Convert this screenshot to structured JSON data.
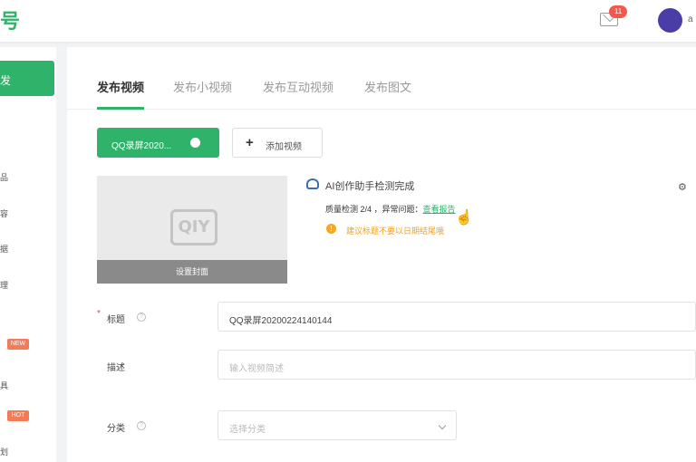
{
  "header": {
    "logo_text": "号",
    "notification_count": "11",
    "user_caption": "a"
  },
  "sidebar": {
    "active_item": "发",
    "marks": [
      "品",
      "容",
      "据",
      "理",
      "具",
      "划"
    ],
    "tags": [
      "NEW",
      "HOT"
    ]
  },
  "tabs": [
    "发布视频",
    "发布小视频",
    "发布互动视频",
    "发布图文"
  ],
  "upload": {
    "file_name": "QQ录屏2020...",
    "add_label": "添加视频"
  },
  "cover": {
    "logo": "QIY",
    "set_cover_label": "设置封面"
  },
  "ai_check": {
    "title": "AI创作助手检测完成",
    "quality_text": "质量检测 2/4 ，异常问题：",
    "report_link": "查看报告",
    "warning": "建议标题不要以日期结尾哦"
  },
  "form": {
    "title_label": "标题",
    "title_value": "QQ录屏20200224140144",
    "desc_label": "描述",
    "desc_placeholder": "输入视频简述",
    "category_label": "分类",
    "category_placeholder": "选择分类"
  },
  "colors": {
    "brand_green": "#2fb36a",
    "warning_orange": "#f5a623",
    "badge_red": "#f5574c"
  }
}
